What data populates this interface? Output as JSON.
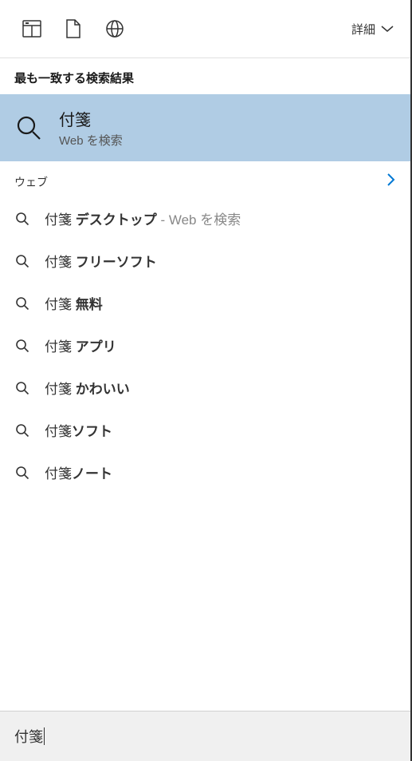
{
  "header": {
    "details_label": "詳細"
  },
  "sections": {
    "best_match_header": "最も一致する検索結果",
    "web_header": "ウェブ"
  },
  "best_match": {
    "title": "付箋",
    "subtitle": "Web を検索"
  },
  "suggestions": [
    {
      "prefix": "付箋 ",
      "bold": "デスクトップ",
      "tail": " - Web を検索"
    },
    {
      "prefix": "付箋 ",
      "bold": "フリーソフト",
      "tail": ""
    },
    {
      "prefix": "付箋 ",
      "bold": "無料",
      "tail": ""
    },
    {
      "prefix": "付箋 ",
      "bold": "アプリ",
      "tail": ""
    },
    {
      "prefix": "付箋 ",
      "bold": "かわいい",
      "tail": ""
    },
    {
      "prefix": "付箋",
      "bold": "ソフト",
      "tail": ""
    },
    {
      "prefix": "付箋",
      "bold": "ノート",
      "tail": ""
    }
  ],
  "search": {
    "value": "付箋"
  }
}
